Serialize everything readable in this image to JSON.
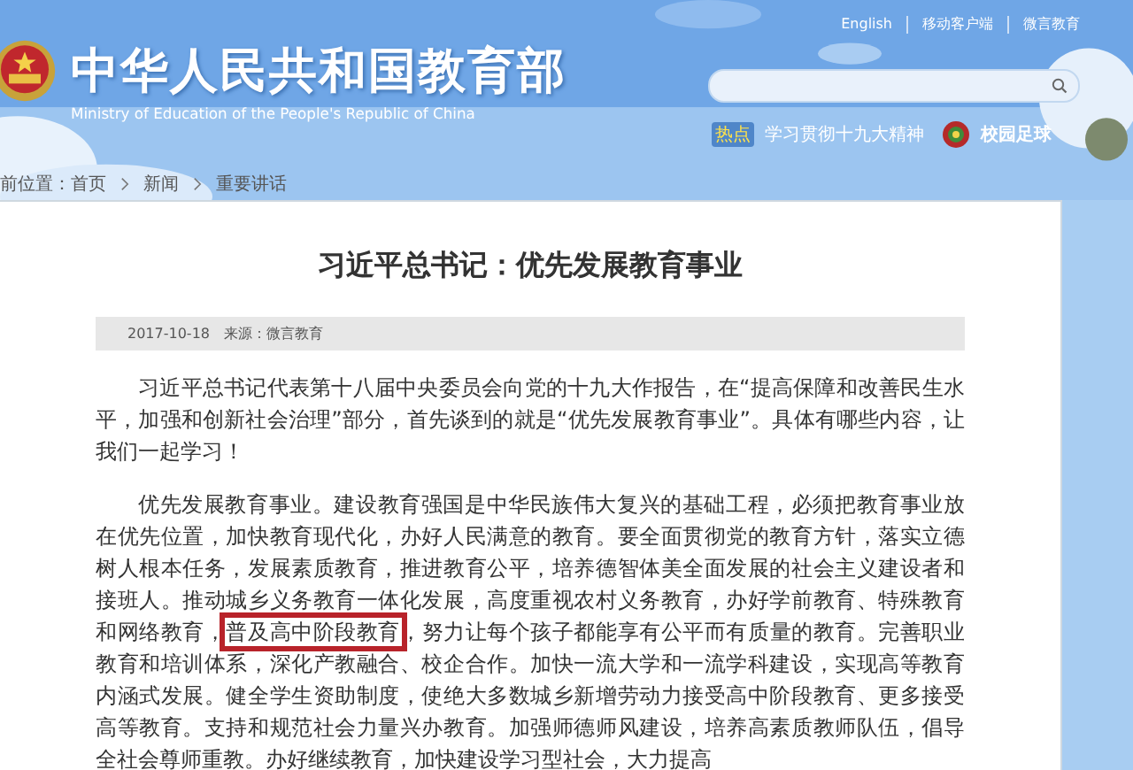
{
  "header": {
    "title": "中华人民共和国教育部",
    "subtitle": "Ministry of Education of the People's Republic of China",
    "top_links": [
      "English",
      "移动客户端",
      "微言教育"
    ],
    "hot_label": "热点",
    "hot_link": "学习贯彻十九大精神",
    "feature_link": "校园足球"
  },
  "breadcrumb": [
    "前位置：首页",
    "新闻",
    "重要讲话"
  ],
  "article": {
    "title": "习近平总书记：优先发展教育事业",
    "date": "2017-10-18",
    "source": "来源：微言教育",
    "intro": "习近平总书记代表第十八届中央委员会向党的十九大作报告，在“提高保障和改善民生水平，加强和创新社会治理”部分，首先谈到的就是“优先发展教育事业”。具体有哪些内容，让我们一起学习！",
    "body_before": "优先发展教育事业。建设教育强国是中华民族伟大复兴的基础工程，必须把教育事业放在优先位置，加快教育现代化，办好人民满意的教育。要全面贯彻党的教育方针，落实立德树人根本任务，发展素质教育，推进教育公平，培养德智体美全面发展的社会主义建设者和接班人。推动城乡义务教育一体化发展，高度重视农村义务教育，办好学前教育、特殊教育和网络教育，",
    "body_highlight": "普及高中阶段教育",
    "body_after": "，努力让每个孩子都能享有公平而有质量的教育。完善职业教育和培训体系，深化产教融合、校企合作。加快一流大学和一流学科建设，实现高等教育内涵式发展。健全学生资助制度，使绝大多数城乡新增劳动力接受高中阶段教育、更多接受高等教育。支持和规范社会力量兴办教育。加强师德师风建设，培养高素质教师队伍，倡导全社会尊师重教。办好继续教育，加快建设学习型社会，大力提高"
  }
}
